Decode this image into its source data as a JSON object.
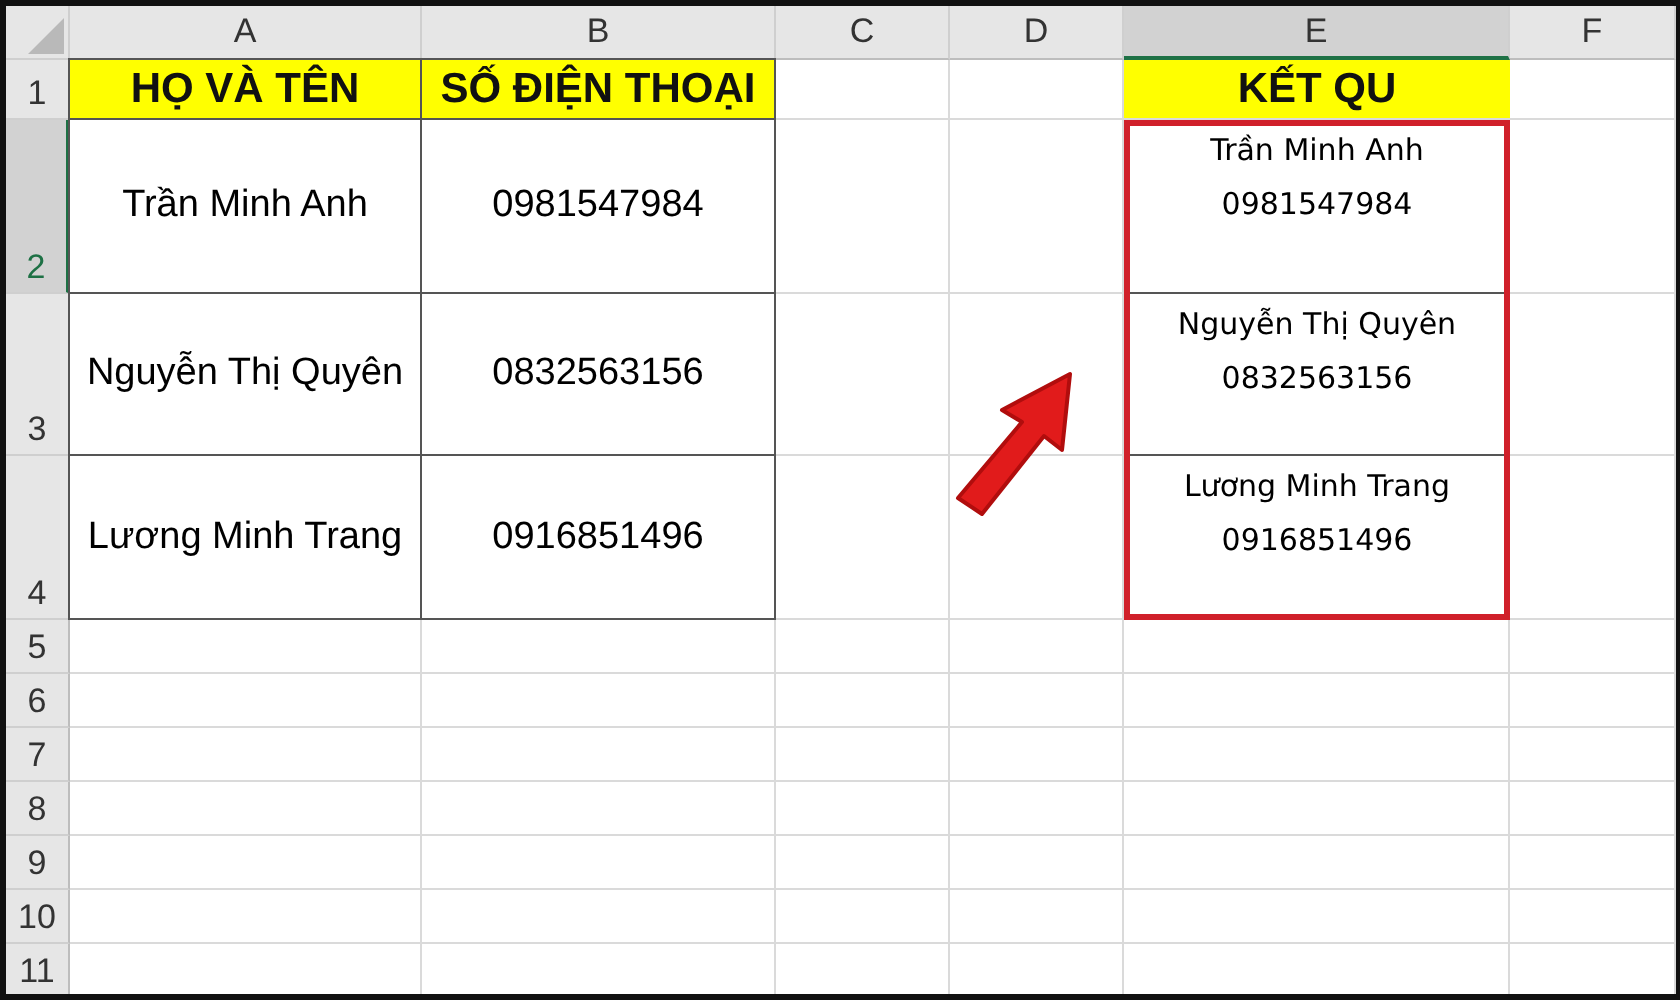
{
  "columns": [
    {
      "label": "A",
      "selected": false
    },
    {
      "label": "B",
      "selected": false
    },
    {
      "label": "C",
      "selected": false
    },
    {
      "label": "D",
      "selected": false
    },
    {
      "label": "E",
      "selected": true
    },
    {
      "label": "F",
      "selected": false
    }
  ],
  "rows": [
    {
      "label": "1",
      "selected": false
    },
    {
      "label": "2",
      "selected": true
    },
    {
      "label": "3",
      "selected": false
    },
    {
      "label": "4",
      "selected": false
    },
    {
      "label": "5",
      "selected": false
    },
    {
      "label": "6",
      "selected": false
    },
    {
      "label": "7",
      "selected": false
    },
    {
      "label": "8",
      "selected": false
    },
    {
      "label": "9",
      "selected": false
    },
    {
      "label": "10",
      "selected": false
    },
    {
      "label": "11",
      "selected": false
    }
  ],
  "headers": {
    "name": "HỌ VÀ TÊN",
    "phone": "SỐ ĐIỆN THOẠI",
    "result": "KẾT QU"
  },
  "records": [
    {
      "name": "Trần Minh Anh",
      "phone": "0981547984"
    },
    {
      "name": "Nguyễn Thị Quyên",
      "phone": "0832563156"
    },
    {
      "name": "Lương Minh Trang",
      "phone": "0916851496"
    }
  ],
  "results": [
    {
      "name": "Trần Minh Anh",
      "phone": "0981547984"
    },
    {
      "name": "Nguyễn Thị Quyên",
      "phone": "0832563156"
    },
    {
      "name": "Lương Minh Trang",
      "phone": "0916851496"
    }
  ]
}
